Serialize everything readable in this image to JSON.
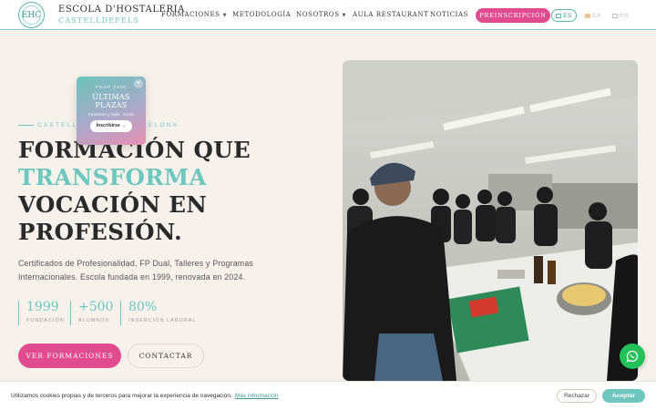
{
  "header": {
    "brand_line1": "ESCOLA D'HOSTALERIA",
    "brand_line2": "CASTELLDEFELS",
    "logo_mark": "EHC",
    "nav": [
      {
        "label": "FORMACIONES",
        "has_dropdown": true
      },
      {
        "label": "METODOLOGÍA",
        "has_dropdown": false
      },
      {
        "label": "NOSOTROS",
        "has_dropdown": true
      },
      {
        "label": "AULA RESTAURANT",
        "has_dropdown": false
      },
      {
        "label": "NOTICIAS",
        "has_dropdown": false
      }
    ],
    "cta_label": "PREINSCRIPCIÓN",
    "languages": [
      {
        "code": "ES",
        "active": true
      },
      {
        "code": "CA",
        "active": false
      },
      {
        "code": "EN",
        "active": false
      }
    ]
  },
  "hero": {
    "eyebrow": "CASTELLDEFELS · BARCELONA",
    "headline_line1": "FORMACIÓN QUE",
    "headline_highlight": "TRANSFORMA",
    "headline_line3": "VOCACIÓN EN",
    "headline_line4": "PROFESIÓN.",
    "description": "Certificados de Profesionalidad, FP Dual, Talleres y Programas Internacionales. Escola fundada en 1999, renovada en 2024.",
    "stats": [
      {
        "value": "1999",
        "label": "FUNDACIÓN"
      },
      {
        "value": "+500",
        "label": "ALUMNOS"
      },
      {
        "value": "80%",
        "label": "INSERCIÓN LABORAL"
      }
    ],
    "primary_button": "VER FORMACIONES",
    "secondary_button": "CONTACTAR"
  },
  "promo": {
    "tag": "FOAP 2026",
    "title_line1": "ÚLTIMAS",
    "title_line2": "PLAZAS",
    "subtitle": "Camarero y Sala · Gratis",
    "cta": "Inscribirse →",
    "close": "×"
  },
  "cookie": {
    "message": "Utilizamos cookies propias y de terceros para mejorar la experiencia de navegación.",
    "more_link": "Más información",
    "reject": "Rechazar",
    "accept": "Aceptar"
  },
  "colors": {
    "accent_teal": "#6ec7bf",
    "accent_pink": "#e14b8f",
    "background": "#f6f1eb",
    "whatsapp_green": "#23c15a"
  },
  "icons": [
    "logo-emblem-icon",
    "chevron-down-icon",
    "flag-es-icon",
    "flag-ca-icon",
    "flag-en-icon",
    "close-icon",
    "whatsapp-icon"
  ]
}
